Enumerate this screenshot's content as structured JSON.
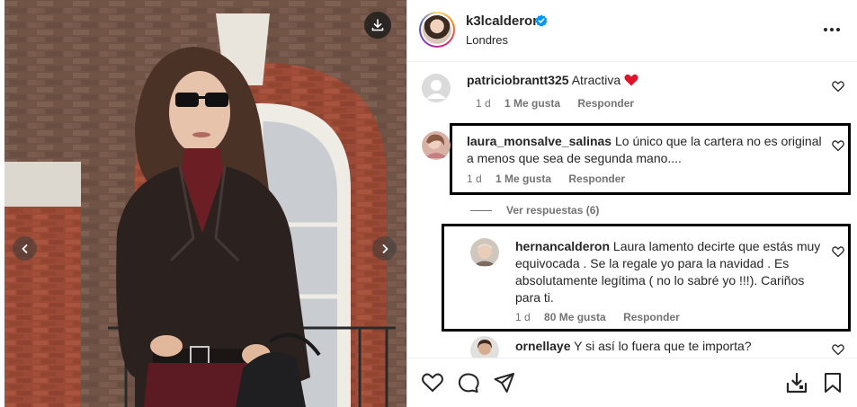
{
  "post": {
    "username": "k3lcalderon",
    "location": "Londres",
    "verified_icon": "verified-badge-icon",
    "more_icon": "more-options-icon"
  },
  "media": {
    "download_icon": "download-icon",
    "prev_icon": "chevron-left-icon",
    "next_icon": "chevron-right-icon"
  },
  "comments": [
    {
      "username": "patriciobrantt325",
      "text": "Atractiva",
      "emoji": "❤️",
      "time": "1 d",
      "likes": "1 Me gusta",
      "reply": "Responder"
    },
    {
      "username": "laura_monsalve_salinas",
      "text": "Lo único que la cartera no es original a menos que sea de segunda mano....",
      "time": "1 d",
      "likes": "1 Me gusta",
      "reply": "Responder"
    }
  ],
  "view_replies": "Ver respuestas (6)",
  "replies": [
    {
      "username": "hernancalderon",
      "text": "Laura lamento decirte que estás muy equivocada . Se la regale yo para la navidad . Es absolutamente legítima ( no lo sabré yo !!!). Cariños para ti.",
      "time": "1 d",
      "likes": "80 Me gusta",
      "reply": "Responder"
    },
    {
      "username": "ornellaye",
      "text": "Y si así lo fuera que te importa?"
    }
  ],
  "actions": {
    "like_icon": "heart-icon",
    "comment_icon": "comment-icon",
    "share_icon": "share-icon",
    "save_icon": "bookmark-icon",
    "save_alt_icon": "save-collection-icon"
  },
  "colors": {
    "like_red": "#ff3040",
    "verified_blue": "#0095f6",
    "meta_gray": "#737373",
    "highlight_border": "#000000"
  }
}
